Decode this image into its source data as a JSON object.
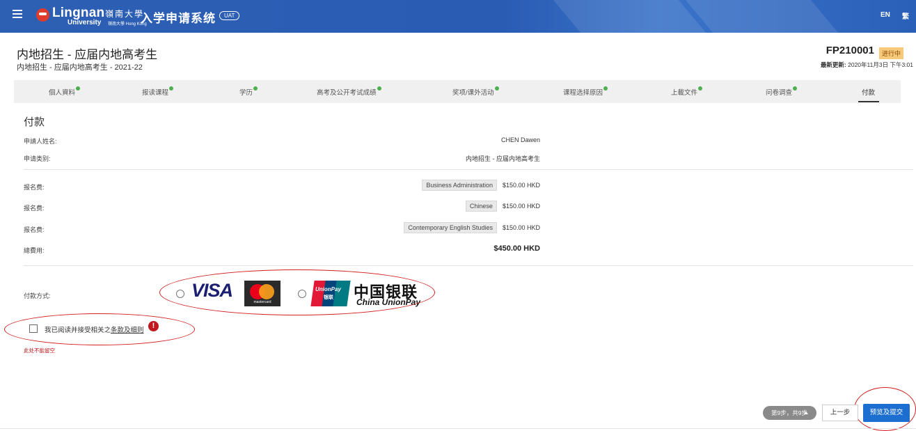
{
  "header": {
    "logo_en": "Lingnan",
    "logo_cn": "嶺南大學",
    "logo_sub": "University",
    "logo_sub2": "嶺南大學 Hong Kong",
    "system_title": "入学申请系统",
    "env_badge": "UAT",
    "lang_en": "EN",
    "lang_tc": "繁"
  },
  "page": {
    "title": "内地招生 - 应届内地高考生",
    "subtitle": "内地招生 - 应届内地高考生 - 2021-22",
    "application_no": "FP210001",
    "status": "进行中",
    "updated_label": "最新更新:",
    "updated_value": "2020年11月3日 下午3:01"
  },
  "tabs": [
    {
      "label": "個人資料",
      "done": true
    },
    {
      "label": "报读课程",
      "done": true
    },
    {
      "label": "学历",
      "done": true
    },
    {
      "label": "高考及公开考试成绩",
      "done": true
    },
    {
      "label": "奖项/课外活动",
      "done": true
    },
    {
      "label": "课程选择原因",
      "done": true
    },
    {
      "label": "上載文件",
      "done": true
    },
    {
      "label": "问卷调查",
      "done": true
    },
    {
      "label": "付款",
      "done": false,
      "active": true
    }
  ],
  "payment": {
    "section_title": "付款",
    "applicant_label": "申請人姓名:",
    "applicant_value": "CHEN Dawen",
    "category_label": "申请类别:",
    "category_value": "内地招生 - 应届内地高考生",
    "fees": [
      {
        "label": "报名费:",
        "course": "Business Administration",
        "amount": "$150.00 HKD"
      },
      {
        "label": "报名费:",
        "course": "Chinese",
        "amount": "$150.00 HKD"
      },
      {
        "label": "报名费:",
        "course": "Contemporary English Studies",
        "amount": "$150.00 HKD"
      }
    ],
    "total_label": "總費用:",
    "total_value": "$450.00 HKD",
    "method_label": "付款方式:",
    "visa_text": "VISA",
    "mastercard_text": "mastercard",
    "unionpay_card_text": "UnionPay",
    "unionpay_card_cn": "银联",
    "unionpay_cn": "中国银联",
    "unionpay_en": "China UnionPay",
    "terms_prefix": "我已阅读并接受相关之",
    "terms_link": "条款及细则",
    "error_text": "此处不能留空",
    "warning_icon_text": "!"
  },
  "footer": {
    "step_text": "第9步，共9步",
    "prev_label": "上一步",
    "submit_label": "预览及提交"
  },
  "colors": {
    "header_blue": "#2d5fb3",
    "submit_blue": "#1c6fd1",
    "status_bg": "#f7c97a",
    "error_red": "#c0181d",
    "annotation_red": "#d21e1e",
    "check_green": "#4cb050"
  }
}
